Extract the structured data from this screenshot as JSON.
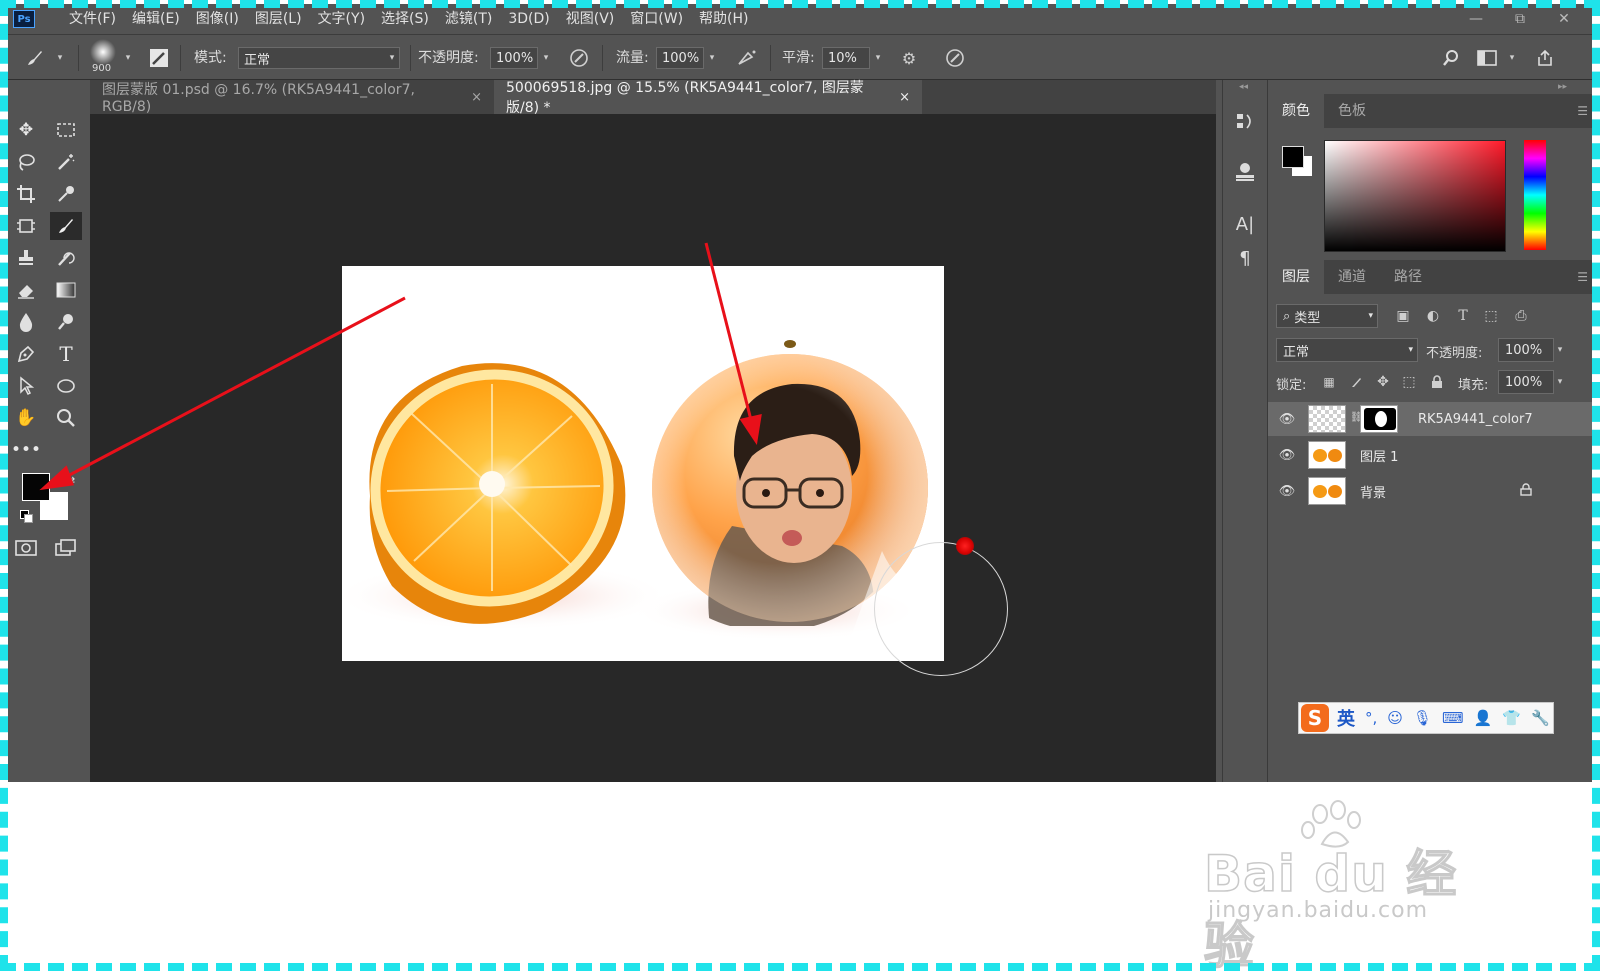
{
  "menu": {
    "app_logo": "Ps",
    "items": [
      "文件(F)",
      "编辑(E)",
      "图像(I)",
      "图层(L)",
      "文字(Y)",
      "选择(S)",
      "滤镜(T)",
      "3D(D)",
      "视图(V)",
      "窗口(W)",
      "帮助(H)"
    ],
    "window_controls": [
      "—",
      "⧉",
      "✕"
    ]
  },
  "options": {
    "brush_size": "900",
    "mode_label": "模式:",
    "mode_value": "正常",
    "opacity_label": "不透明度:",
    "opacity_value": "100%",
    "flow_label": "流量:",
    "flow_value": "100%",
    "smooth_label": "平滑:",
    "smooth_value": "10%"
  },
  "tabs": [
    {
      "label": "图层蒙版 01.psd @ 16.7% (RK5A9441_color7, RGB/8)",
      "close": "×"
    },
    {
      "label": "500069518.jpg @ 15.5% (RK5A9441_color7, 图层蒙版/8) *",
      "close": "×"
    }
  ],
  "color_panel": {
    "tabs": [
      "颜色",
      "色板"
    ],
    "foreground": "#000000",
    "background": "#ffffff"
  },
  "layers_panel": {
    "tabs": [
      "图层",
      "通道",
      "路径"
    ],
    "filter_kind": "类型",
    "blend_mode": "正常",
    "opacity_label": "不透明度:",
    "opacity_value": "100%",
    "lock_label": "锁定:",
    "fill_label": "填充:",
    "fill_value": "100%",
    "layers": [
      {
        "name": "RK5A9441_color7",
        "selected": true,
        "has_mask": true
      },
      {
        "name": "图层 1",
        "selected": false,
        "has_mask": false
      },
      {
        "name": "背景",
        "selected": false,
        "locked": true
      }
    ]
  },
  "ime": {
    "logo": "S",
    "mode": "英"
  },
  "watermark": {
    "main": "Bai du 经验",
    "sub": "jingyan.baidu.com"
  },
  "colors": {
    "frame": "#1fe3ea",
    "arrow": "#e8101a",
    "panel": "#535353",
    "canvas": "#282828"
  }
}
